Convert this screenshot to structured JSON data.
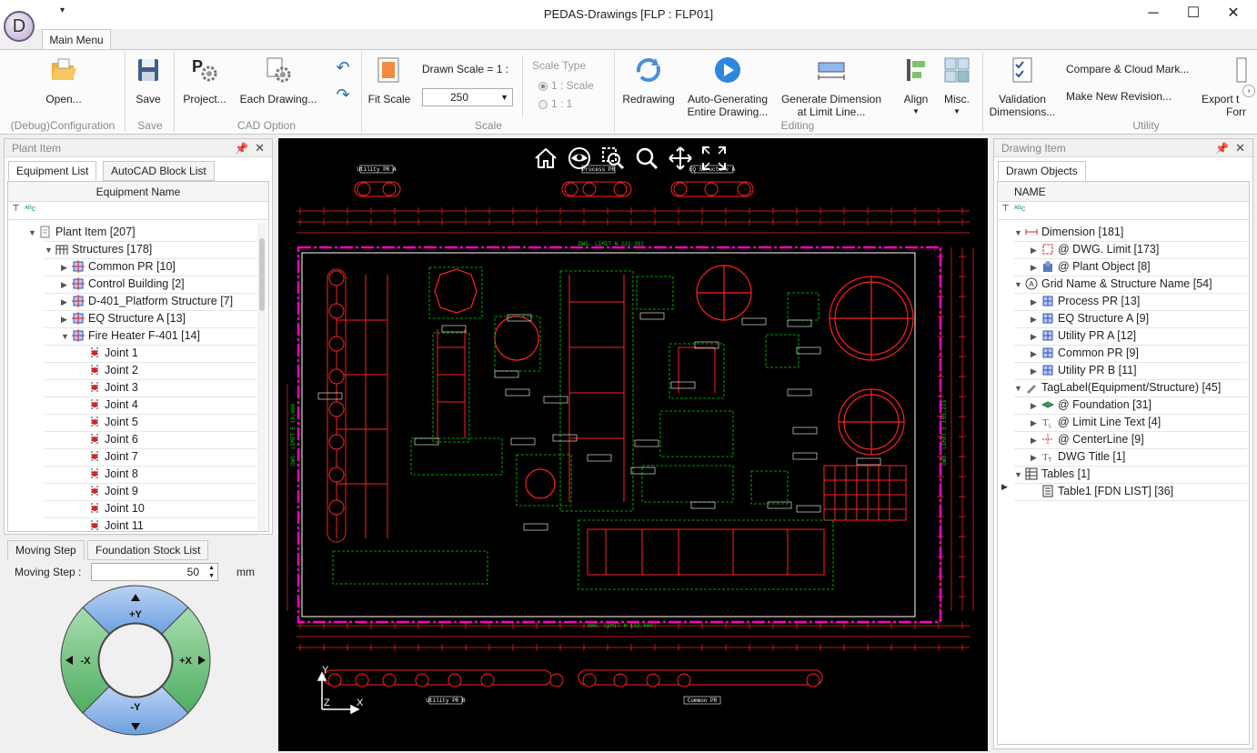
{
  "window": {
    "title": "PEDAS-Drawings [FLP : FLP01]",
    "logo_letter": "D",
    "minimize": "─",
    "maximize": "☐",
    "close": "✕",
    "qat": "▾"
  },
  "menu": {
    "tab": "Main Menu"
  },
  "ribbon": {
    "open": "Open...",
    "config_group": "(Debug)Configuration",
    "save": "Save",
    "save_group": "Save",
    "project": "Project...",
    "each_drawing": "Each Drawing...",
    "cad_group": "CAD Option",
    "fit_scale": "Fit Scale",
    "drawn_scale_label": "Drawn Scale = 1 :",
    "drawn_scale_value": "250",
    "scale_type_label": "Scale Type",
    "scale_opt1": "1 : Scale",
    "scale_opt2": "1 : 1",
    "scale_group": "Scale",
    "redrawing": "Redrawing",
    "auto_gen_1": "Auto-Generating",
    "auto_gen_2": "Entire Drawing...",
    "gen_dim_1": "Generate Dimension",
    "gen_dim_2": "at Limit Line...",
    "align": "Align",
    "misc": "Misc.",
    "editing_group": "Editing",
    "validation_1": "Validation",
    "validation_2": "Dimensions...",
    "compare": "Compare & Cloud Mark...",
    "make_rev": "Make New Revision...",
    "export_1": "Export t",
    "export_2": "Forr",
    "utility_group": "Utility"
  },
  "plant_panel": {
    "title": "Plant Item",
    "tab1": "Equipment List",
    "tab2": "AutoCAD Block List",
    "col": "Equipment Name",
    "items": [
      {
        "label": "Plant Item [207]",
        "level": 0,
        "exp": "▼"
      },
      {
        "label": "Structures [178]",
        "level": 1,
        "exp": "▼"
      },
      {
        "label": "Common PR [10]",
        "level": 2,
        "exp": "▶"
      },
      {
        "label": "Control Building [2]",
        "level": 2,
        "exp": "▶"
      },
      {
        "label": "D-401_Platform Structure [7]",
        "level": 2,
        "exp": "▶"
      },
      {
        "label": "EQ Structure A [13]",
        "level": 2,
        "exp": "▶"
      },
      {
        "label": "Fire Heater F-401 [14]",
        "level": 2,
        "exp": "▼"
      },
      {
        "label": "Joint 1",
        "level": 3,
        "exp": ""
      },
      {
        "label": "Joint 2",
        "level": 3,
        "exp": ""
      },
      {
        "label": "Joint 3",
        "level": 3,
        "exp": ""
      },
      {
        "label": "Joint 4",
        "level": 3,
        "exp": ""
      },
      {
        "label": "Joint 5",
        "level": 3,
        "exp": ""
      },
      {
        "label": "Joint 6",
        "level": 3,
        "exp": ""
      },
      {
        "label": "Joint 7",
        "level": 3,
        "exp": ""
      },
      {
        "label": "Joint 8",
        "level": 3,
        "exp": ""
      },
      {
        "label": "Joint 9",
        "level": 3,
        "exp": ""
      },
      {
        "label": "Joint 10",
        "level": 3,
        "exp": ""
      },
      {
        "label": "Joint 11",
        "level": 3,
        "exp": ""
      }
    ]
  },
  "moving": {
    "tab1": "Moving Step",
    "tab2": "Foundation Stock List",
    "label": "Moving Step :",
    "value": "50",
    "unit": "mm",
    "up": "+Y",
    "down": "-Y",
    "left": "-X",
    "right": "+X"
  },
  "drawing_panel": {
    "title": "Drawing Item",
    "tab": "Drawn Objects",
    "col": "NAME",
    "items": [
      {
        "label": "Dimension [181]",
        "level": 0,
        "exp": "▼",
        "icon": "dimension"
      },
      {
        "label": "@ DWG. Limit [173]",
        "level": 1,
        "exp": "▶",
        "icon": "limit"
      },
      {
        "label": "@ Plant Object [8]",
        "level": 1,
        "exp": "▶",
        "icon": "plant"
      },
      {
        "label": "Grid Name & Structure Name [54]",
        "level": 0,
        "exp": "▼",
        "icon": "grid"
      },
      {
        "label": "Process PR [13]",
        "level": 1,
        "exp": "▶",
        "icon": "struct"
      },
      {
        "label": "EQ Structure A [9]",
        "level": 1,
        "exp": "▶",
        "icon": "struct"
      },
      {
        "label": "Utility PR A [12]",
        "level": 1,
        "exp": "▶",
        "icon": "struct"
      },
      {
        "label": "Common PR [9]",
        "level": 1,
        "exp": "▶",
        "icon": "struct"
      },
      {
        "label": "Utility PR B [11]",
        "level": 1,
        "exp": "▶",
        "icon": "struct"
      },
      {
        "label": "TagLabel(Equipment/Structure) [45]",
        "level": 0,
        "exp": "▼",
        "icon": "tag"
      },
      {
        "label": "@ Foundation [31]",
        "level": 1,
        "exp": "▶",
        "icon": "foundation"
      },
      {
        "label": "@ Limit Line Text [4]",
        "level": 1,
        "exp": "▶",
        "icon": "text"
      },
      {
        "label": "@ CenterLine [9]",
        "level": 1,
        "exp": "▶",
        "icon": "center"
      },
      {
        "label": "DWG Title [1]",
        "level": 1,
        "exp": "▶",
        "icon": "title"
      },
      {
        "label": "Tables [1]",
        "level": 0,
        "exp": "▼",
        "icon": "table"
      },
      {
        "label": "Table1 [FDN LIST] [36]",
        "level": 1,
        "exp": "",
        "icon": "table1"
      }
    ]
  },
  "cad": {
    "top_labels": [
      "Utility PR A",
      "Process PR",
      "EQ Structure A"
    ],
    "bottom_labels": [
      "Utility PR B",
      "Common PR"
    ],
    "limit_top": "DWG. LIMIT N 221,392",
    "limit_bottom": "DWG. LIMIT N 132,600",
    "limit_left": "DWG. LIMIT E 18,000",
    "limit_right": "DWG. LIMIT E 153,273",
    "axis_x": "X",
    "axis_y": "Y",
    "axis_z": "Z"
  },
  "colors": {
    "accent": "#2b579a",
    "cad_red": "#ff2020",
    "cad_green": "#00d000",
    "cad_magenta": "#ff00c0",
    "cad_white": "#ffffff"
  }
}
